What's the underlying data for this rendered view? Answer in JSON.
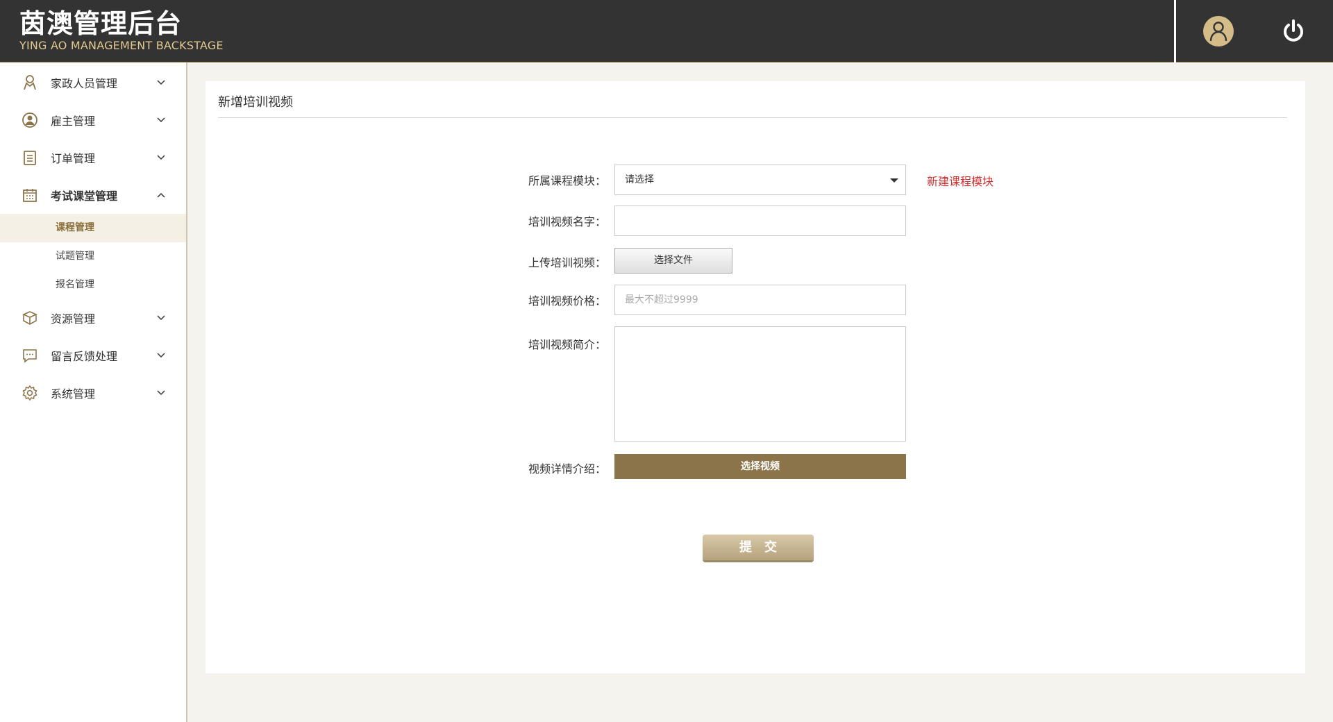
{
  "header": {
    "title_cn": "茵澳管理后台",
    "title_en": "YING AO MANAGEMENT BACKSTAGE",
    "avatar_icon": "user-icon",
    "power_icon": "power-icon"
  },
  "sidebar": {
    "items": [
      {
        "label": "家政人员管理",
        "icon": "worker-icon",
        "expanded": false
      },
      {
        "label": "雇主管理",
        "icon": "user-circle-icon",
        "expanded": false
      },
      {
        "label": "订单管理",
        "icon": "clipboard-icon",
        "expanded": false
      },
      {
        "label": "考试课堂管理",
        "icon": "calendar-icon",
        "expanded": true
      },
      {
        "label": "资源管理",
        "icon": "box-icon",
        "expanded": false
      },
      {
        "label": "留言反馈处理",
        "icon": "message-icon",
        "expanded": false
      },
      {
        "label": "系统管理",
        "icon": "gear-icon",
        "expanded": false
      }
    ],
    "sub_items": [
      {
        "label": "课程管理",
        "active": true
      },
      {
        "label": "试题管理",
        "active": false
      },
      {
        "label": "报名管理",
        "active": false
      }
    ]
  },
  "panel": {
    "title": "新增培训视频"
  },
  "form": {
    "module_label": "所属课程模块：",
    "module_value": "请选择",
    "new_module_link": "新建课程模块",
    "name_label": "培训视频名字：",
    "name_value": "",
    "upload_label": "上传培训视频：",
    "upload_button": "选择文件",
    "price_label": "培训视频价格：",
    "price_placeholder": "最大不超过9999",
    "intro_label": "培训视频简介：",
    "detail_label": "视频详情介绍：",
    "detail_button": "选择视频",
    "submit": "提交"
  },
  "colors": {
    "header_bg": "#333333",
    "accent_gold": "#8c744a",
    "brand_en": "#e2c98f",
    "link_red": "#d32f2f",
    "page_bg": "#f5f3ee"
  }
}
